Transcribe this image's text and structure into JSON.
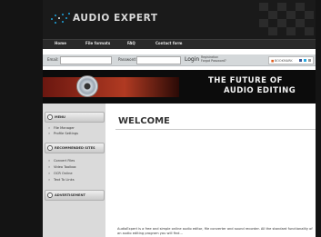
{
  "site": {
    "logo": "AUDIO EXPERT"
  },
  "nav": {
    "items": [
      "Home",
      "File formats",
      "FAQ",
      "Contact form"
    ]
  },
  "login": {
    "email_label": "Email:",
    "password_label": "Password:",
    "login_label": "Login",
    "registration": "Registration",
    "forgot": "Forgot Password?",
    "social_label": "BOOKMARK"
  },
  "banner": {
    "line1": "THE FUTURE OF",
    "line2": "AUDIO EDITING"
  },
  "sidebar": {
    "menu_title": "MENU",
    "menu_items": [
      "File Manager",
      "Profile Settings"
    ],
    "recommended_title": "RECOMMENDED SITES",
    "recommended_items": [
      "Convert Files",
      "Video Toolbox",
      "OCR Online",
      "Text To Links"
    ],
    "advert_title": "ADVERTISEMENT"
  },
  "main": {
    "title": "WELCOME",
    "description": "AudioExpert is a free and simple online audio editor, file converter and sound recorder. All the standard functionality of an audio editing program you will find..."
  },
  "colors": {
    "accent": "#1fa6e0",
    "banner_red": "#b03a22",
    "header_bg": "#1a1a1a"
  }
}
